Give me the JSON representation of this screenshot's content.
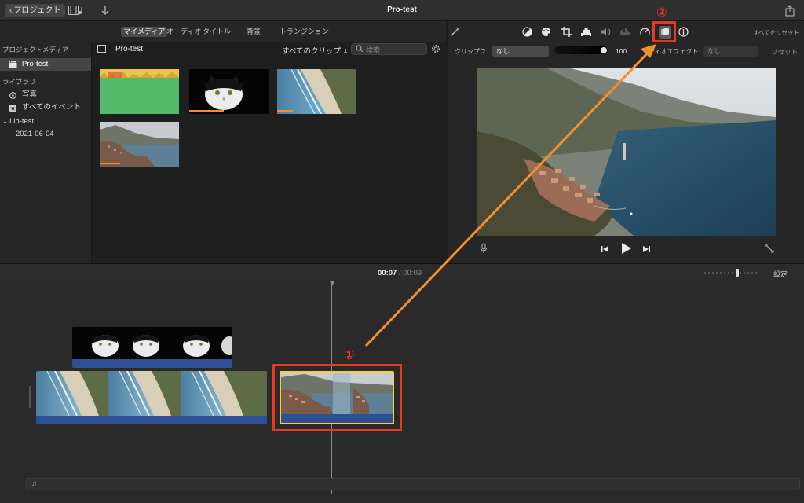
{
  "window": {
    "title": "Pro-test",
    "back_label": "プロジェクト"
  },
  "browser_tabs": [
    {
      "label": "マイメディア",
      "active": true
    },
    {
      "label": "オーディオ",
      "active": false
    },
    {
      "label": "タイトル",
      "active": false
    },
    {
      "label": "背景",
      "active": false
    },
    {
      "label": "トランジション",
      "active": false
    }
  ],
  "sidebar": {
    "project_media_heading": "プロジェクトメディア",
    "project_item": "Pro-test",
    "library_heading": "ライブラリ",
    "photos": "写真",
    "all_events": "すべてのイベント",
    "library_name": "Lib-test",
    "event_date": "2021-06-04"
  },
  "browser": {
    "title": "Pro-test",
    "clip_filter": "すべてのクリップ",
    "search_placeholder": "検索"
  },
  "inspector": {
    "reset_all": "すべてをリセット",
    "clip_filter_label": "クリップフ…",
    "clip_filter_value": "なし",
    "volume_value": "100",
    "audio_effect_label": "ーディオエフェクト:",
    "audio_effect_value": "なし",
    "reset": "リセット"
  },
  "timeline": {
    "current_time": "00:07",
    "separator": "/",
    "total_time": "00:09",
    "settings_label": "設定"
  },
  "annotations": {
    "step1": "①",
    "step2": "②"
  },
  "colors": {
    "accent_orange": "#f0922b",
    "callout_red": "#e8391f",
    "selection_yellow": "#f3d23c",
    "clip_bar_blue": "#2e4f94"
  }
}
